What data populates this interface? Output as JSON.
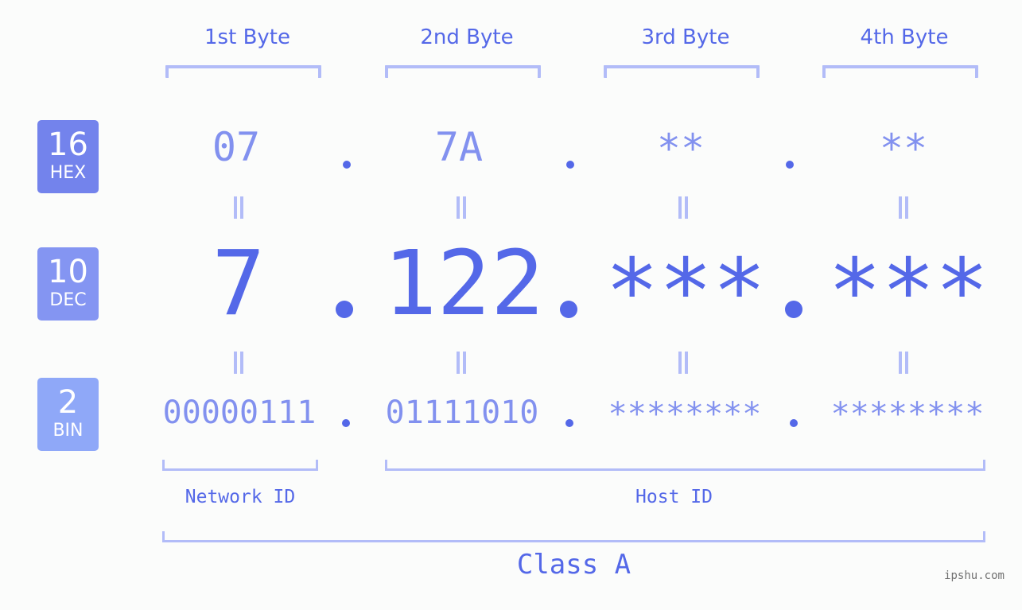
{
  "header": {
    "bytes": [
      "1st Byte",
      "2nd Byte",
      "3rd Byte",
      "4th Byte"
    ]
  },
  "badges": [
    {
      "number": "16",
      "label": "HEX",
      "color": "#7383ec"
    },
    {
      "number": "10",
      "label": "DEC",
      "color": "#8495f2"
    },
    {
      "number": "2",
      "label": "BIN",
      "color": "#8fa8f8"
    }
  ],
  "hex": [
    "07",
    "7A",
    "**",
    "**"
  ],
  "dec": [
    "7",
    "122",
    "***",
    "***"
  ],
  "bin": [
    "00000111",
    "01111010",
    "********",
    "********"
  ],
  "separator": ".",
  "segments": {
    "network_label": "Network ID",
    "host_label": "Host ID"
  },
  "ip_class": "Class A",
  "watermark": "ipshu.com",
  "colors": {
    "accent": "#5468e8",
    "light_value": "#8291ef",
    "bracket": "#b2bcf8",
    "background": "#fbfcfb"
  }
}
